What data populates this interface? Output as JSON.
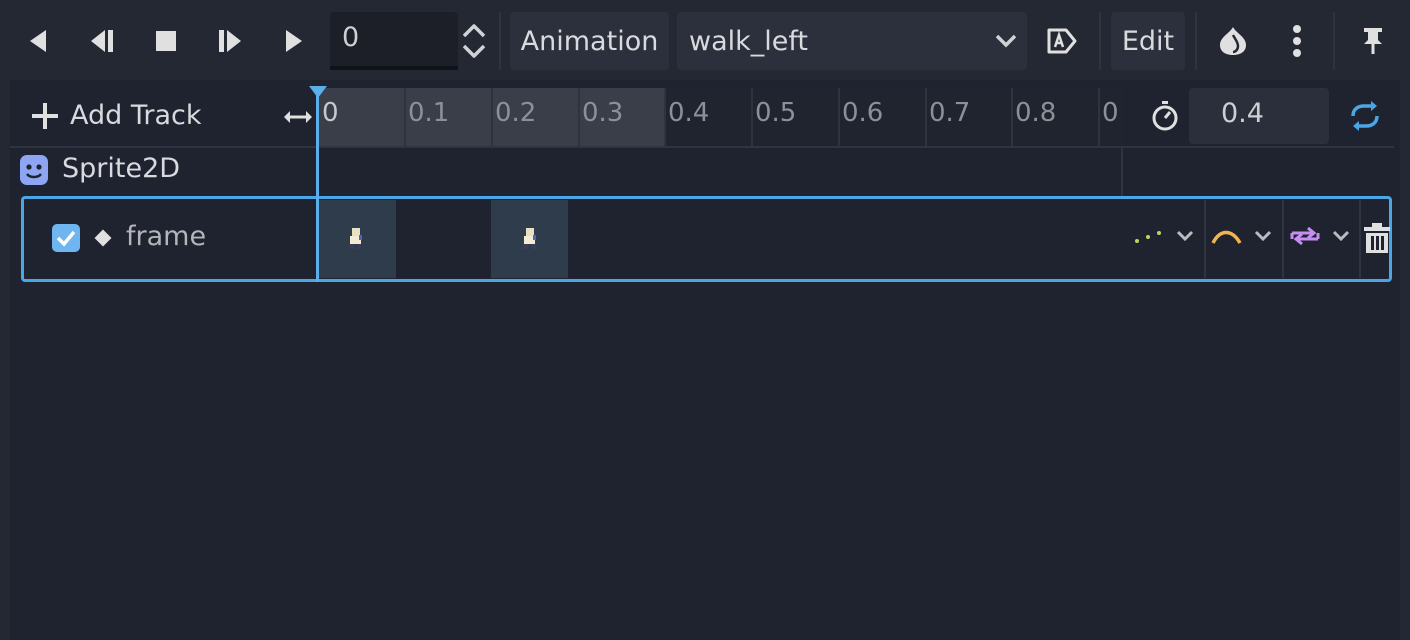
{
  "toolbar": {
    "play_backwards_label": "play-backwards",
    "frame_value": "0",
    "animation_button": "Animation",
    "animation_select": "walk_left",
    "edit_button": "Edit"
  },
  "timeline": {
    "add_track_label": "Add Track",
    "ruler_ticks": [
      "0",
      "0.1",
      "0.2",
      "0.3",
      "0.4",
      "0.5",
      "0.6",
      "0.7",
      "0.8",
      "0"
    ],
    "length_value": "0.4"
  },
  "tracks": {
    "node_name": "Sprite2D",
    "property_name": "frame"
  },
  "colors": {
    "accent": "#5caeea",
    "background": "#232833",
    "panel": "#1f2330"
  }
}
